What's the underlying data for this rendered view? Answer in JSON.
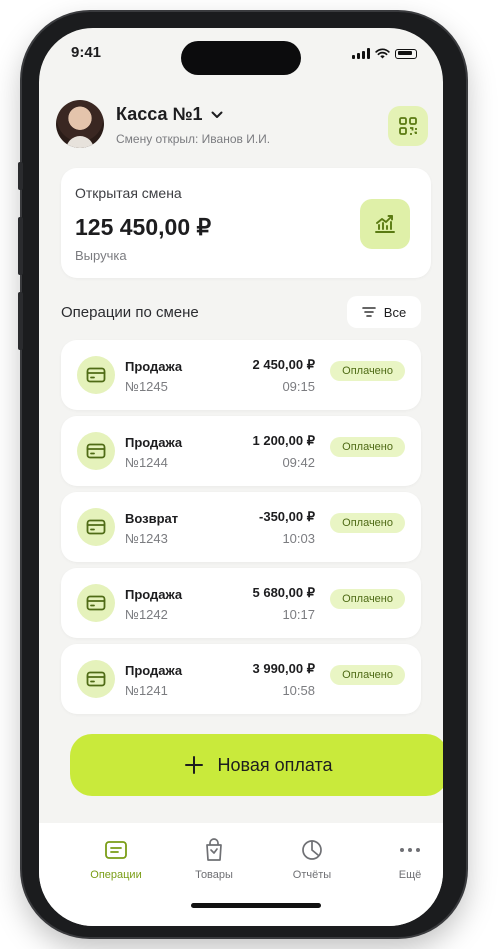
{
  "status_bar": {
    "time": "9:41"
  },
  "header": {
    "register_name": "Касса №1",
    "opened_by": "Смену открыл: Иванов И.И."
  },
  "shift": {
    "title": "Открытая смена",
    "amount": "125 450,00 ₽",
    "subtitle": "Выручка"
  },
  "operations": {
    "title": "Операции по смене",
    "filter_label": "Все",
    "items": [
      {
        "type": "Продажа",
        "number": "№1245",
        "amount": "2 450,00 ₽",
        "time": "09:15",
        "status": "Оплачено"
      },
      {
        "type": "Продажа",
        "number": "№1244",
        "amount": "1 200,00 ₽",
        "time": "09:42",
        "status": "Оплачено"
      },
      {
        "type": "Возврат",
        "number": "№1243",
        "amount": "-350,00 ₽",
        "time": "10:03",
        "status": "Оплачено"
      },
      {
        "type": "Продажа",
        "number": "№1242",
        "amount": "5 680,00 ₽",
        "time": "10:17",
        "status": "Оплачено"
      },
      {
        "type": "Продажа",
        "number": "№1241",
        "amount": "3 990,00 ₽",
        "time": "10:58",
        "status": "Оплачено"
      }
    ]
  },
  "new_payment_label": "Новая оплата",
  "tabs": [
    {
      "label": "Операции",
      "icon": "receipt-icon",
      "active": true
    },
    {
      "label": "Товары",
      "icon": "bag-icon",
      "active": false
    },
    {
      "label": "Отчёты",
      "icon": "pie-chart-icon",
      "active": false
    },
    {
      "label": "Ещё",
      "icon": "more-icon",
      "active": false
    }
  ],
  "colors": {
    "accent": "#c9ea3b",
    "accent_soft": "#e5f2bb",
    "active_tab": "#7a9d16",
    "background": "#f4f4f2"
  }
}
